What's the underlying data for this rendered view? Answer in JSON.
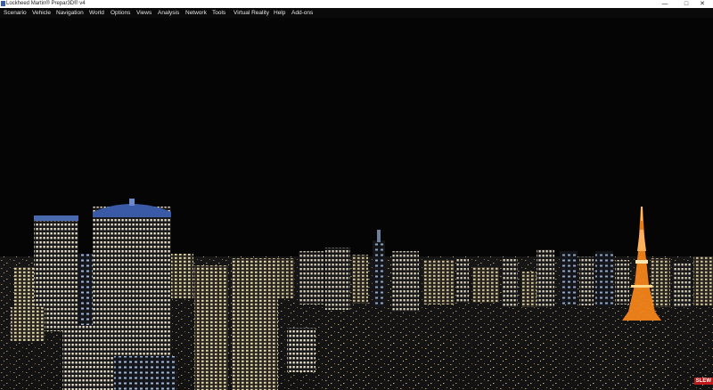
{
  "window": {
    "title": "Lockheed Martin® Prepar3D® v4",
    "controls": {
      "minimize": "—",
      "maximize": "□",
      "close": "✕"
    }
  },
  "menu": [
    {
      "label": "Scenario"
    },
    {
      "label": "Vehicle"
    },
    {
      "label": "Navigation"
    },
    {
      "label": "World"
    },
    {
      "label": "Options"
    },
    {
      "label": "Views"
    },
    {
      "label": "Analysis"
    },
    {
      "label": "Network"
    },
    {
      "label": "Tools"
    },
    {
      "label": "Virtual Reality"
    },
    {
      "label": "Help"
    },
    {
      "label": "Add-ons"
    }
  ],
  "status": {
    "slew": "SLEW"
  },
  "colors": {
    "sky": "#050505",
    "window_light": "#f2e6c4",
    "tower_orange": "#ff8a1a",
    "slew_badge": "#c01818"
  }
}
